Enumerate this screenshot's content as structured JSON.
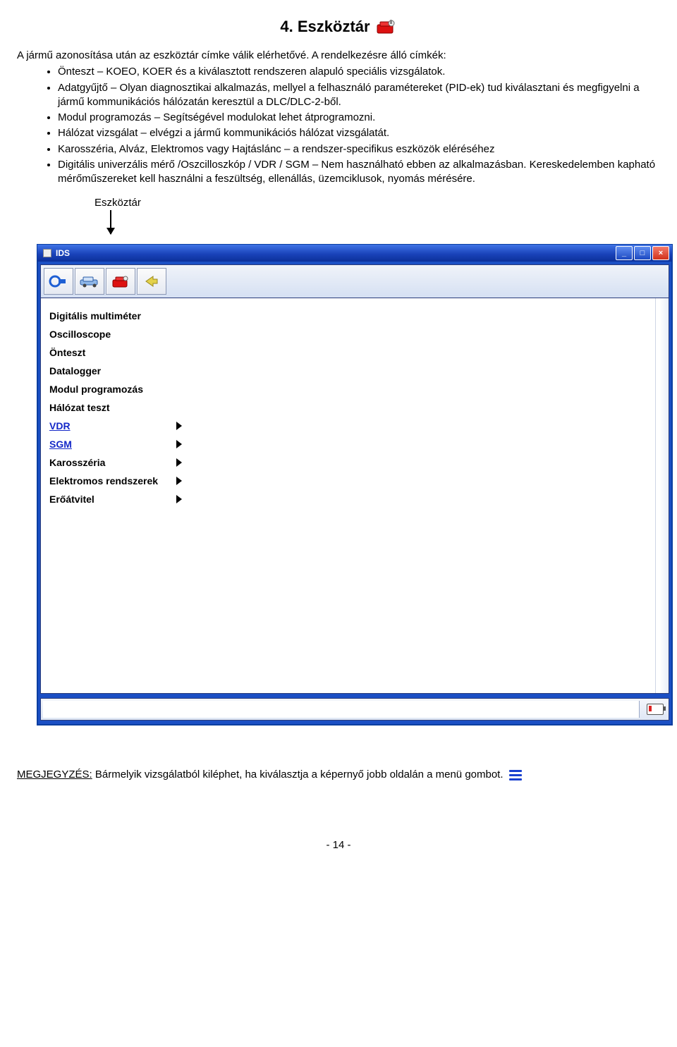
{
  "heading": "4. Eszköztár",
  "intro": "A jármű azonosítása után az eszköztár címke válik elérhetővé. A rendelkezésre álló címkék:",
  "bullets": [
    "Önteszt – KOEO, KOER és a kiválasztott rendszeren alapuló speciális vizsgálatok.",
    "Adatgyűjtő – Olyan diagnosztikai alkalmazás, mellyel a felhasználó paramétereket (PID-ek) tud kiválasztani és megfigyelni a jármű kommunikációs hálózatán keresztül a DLC/DLC-2-ből.",
    "Modul programozás – Segítségével modulokat lehet átprogramozni.",
    "Hálózat vizsgálat – elvégzi a jármű kommunikációs hálózat vizsgálatát.",
    "Karosszéria, Alváz, Elektromos vagy Hajtáslánc – a rendszer-specifikus eszközök eléréséhez",
    "Digitális univerzális mérő /Oszcilloszkóp / VDR / SGM – Nem használható ebben az alkalmazásban. Kereskedelemben kapható mérőműszereket kell használni a feszültség, ellenállás, üzemciklusok, nyomás mérésére."
  ],
  "callout": "Eszköztár",
  "window": {
    "title": "IDS",
    "min": "_",
    "max": "□",
    "close": "×"
  },
  "menu": [
    {
      "label": "Digitális multiméter",
      "submenu": false,
      "link": false
    },
    {
      "label": "Oscilloscope",
      "submenu": false,
      "link": false
    },
    {
      "label": "Önteszt",
      "submenu": false,
      "link": false
    },
    {
      "label": "Datalogger",
      "submenu": false,
      "link": false
    },
    {
      "label": "Modul programozás",
      "submenu": false,
      "link": false
    },
    {
      "label": "Hálózat teszt",
      "submenu": false,
      "link": false
    },
    {
      "label": "VDR",
      "submenu": true,
      "link": true
    },
    {
      "label": "SGM",
      "submenu": true,
      "link": true
    },
    {
      "label": "Karosszéria",
      "submenu": true,
      "link": false
    },
    {
      "label": "Elektromos rendszerek",
      "submenu": true,
      "link": false
    },
    {
      "label": "Erőátvitel",
      "submenu": true,
      "link": false
    }
  ],
  "note_label": "MEGJEGYZÉS:",
  "note_text": "Bármelyik vizsgálatból kiléphet, ha kiválasztja a képernyő jobb oldalán a menü gombot.",
  "page_number": "- 14 -"
}
